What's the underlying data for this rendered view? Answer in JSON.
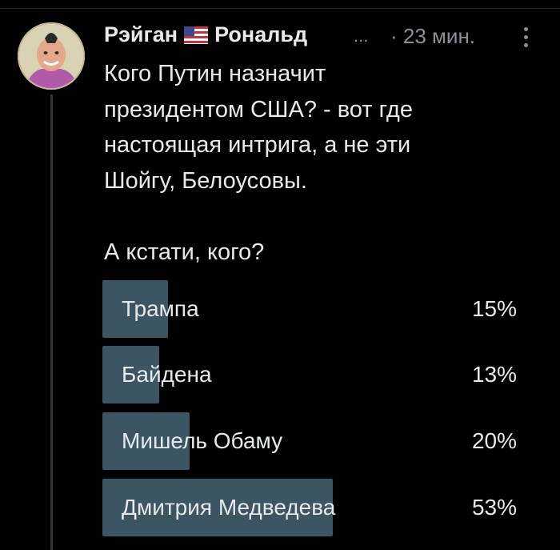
{
  "author": {
    "name_first": "Рэйган",
    "name_second": "Рональд",
    "flag_icon": "us-flag-icon",
    "truncation": "...",
    "separator": "·",
    "time": "23 мин."
  },
  "post": {
    "text": "Кого Путин назначит\nпрезидентом США? - вот где\nнастоящая интрига, а не эти\nШойгу, Белоусовы.\n\nА кстати, кого?"
  },
  "poll": {
    "options": [
      {
        "label": "Трампа",
        "percent": "15%",
        "value": 15
      },
      {
        "label": "Байдена",
        "percent": "13%",
        "value": 13
      },
      {
        "label": "Мишель Обаму",
        "percent": "20%",
        "value": 20
      },
      {
        "label": "Дмитрия Медведева",
        "percent": "53%",
        "value": 53
      }
    ],
    "bar_color": "#3b5563"
  },
  "colors": {
    "background": "#000000",
    "text": "#e7e9ea",
    "muted": "#8b9096"
  }
}
